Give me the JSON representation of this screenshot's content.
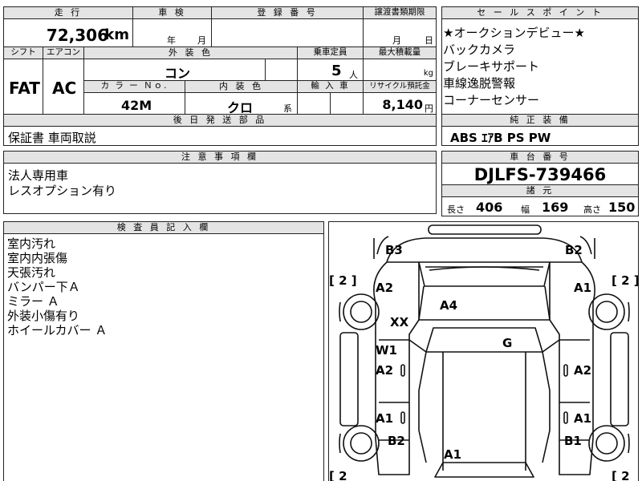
{
  "top": {
    "mileage_label": "走 行",
    "mileage_value": "72,306",
    "mileage_unit": "km",
    "inspection_label": "車 検",
    "inspection_year": "年",
    "inspection_month": "月",
    "registration_label": "登 録 番 号",
    "transfer_label": "譲渡書類期限",
    "transfer_month": "月",
    "transfer_day": "日"
  },
  "row2": {
    "shift_label": "シフト",
    "aircon_label": "エアコン",
    "exterior_label": "外 装 色",
    "exterior_value": "コン",
    "capacity_label": "乗車定員",
    "capacity_value": "5",
    "capacity_unit": "人",
    "max_load_label": "最大積載量",
    "max_load_unit": "kg",
    "shift_value": "FAT",
    "aircon_value": "AC",
    "color_no_label": "カ ラ ー Ｎｏ.",
    "interior_label": "内 装 色",
    "import_label": "輸 入 車",
    "recycle_label": "リサイクル預託金",
    "color_no_value": "42M",
    "interior_value": "クロ",
    "interior_suffix": "系",
    "recycle_value": "8,140",
    "recycle_unit": "円"
  },
  "sales": {
    "label": "セ ー ル ス ポ イ ン ト",
    "points": [
      "★オークションデビュー★",
      "バックカメラ",
      "ブレーキサポート",
      "車線逸脱警報",
      "コーナーセンサー"
    ]
  },
  "delivery": {
    "label": "後 日 発 送 部 品",
    "value": "保証書 車両取説"
  },
  "genuine": {
    "label": "純 正 装 備",
    "value": "ABS ｴｱB PS PW"
  },
  "notes": {
    "label": "注 意 事 項 欄",
    "lines": [
      "法人専用車",
      "レスオプション有り"
    ]
  },
  "chassis": {
    "label": "車 台 番 号",
    "value": "DJLFS-739466"
  },
  "specs": {
    "label": "諸 元",
    "length_label": "長さ",
    "length_value": "406",
    "width_label": "幅",
    "width_value": "169",
    "height_label": "高さ",
    "height_value": "150"
  },
  "inspector": {
    "label": "検 査 員 記 入 欄",
    "lines": [
      "室内汚れ",
      "室内内張傷",
      "天張汚れ",
      "バンパー下Ａ",
      "ミラー Ａ",
      "外装小傷有り",
      "ホイールカバー Ａ"
    ]
  },
  "diagram": {
    "tire_tl": "[ 2 ]",
    "tire_tr": "[ 2 ]",
    "tire_bl": "[ 2",
    "tire_br": "[ 2",
    "marks": {
      "rear_left": "B3",
      "rear_right": "B2",
      "left_rear_fender": "A2",
      "right_rear_fender": "A1",
      "rear_glass": "A4",
      "left_c_pillar": "XX",
      "roof": "G",
      "left_rear_window": "W1",
      "left_rear_door": "A2",
      "right_rear_door": "A2",
      "left_front_door": "A1",
      "right_front_door": "A1",
      "left_front_fender": "B2",
      "right_front_fender": "B1",
      "hood": "A1"
    }
  }
}
